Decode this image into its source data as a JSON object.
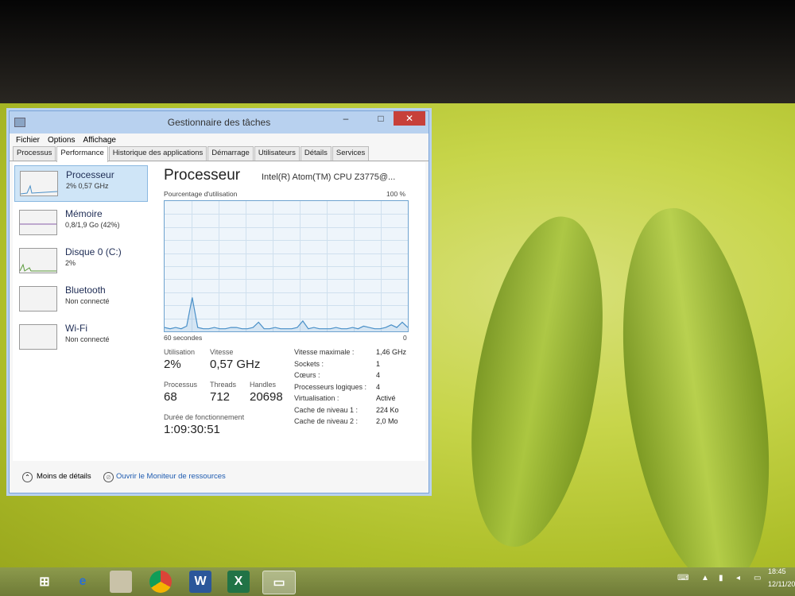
{
  "window": {
    "title": "Gestionnaire des tâches",
    "minimize": "–",
    "maximize": "□",
    "close": "✕"
  },
  "menu": [
    "Fichier",
    "Options",
    "Affichage"
  ],
  "tabs": [
    "Processus",
    "Performance",
    "Historique des applications",
    "Démarrage",
    "Utilisateurs",
    "Détails",
    "Services"
  ],
  "sidebar": {
    "items": [
      {
        "name": "Processeur",
        "sub": "2% 0,57 GHz"
      },
      {
        "name": "Mémoire",
        "sub": "0,8/1,9 Go (42%)"
      },
      {
        "name": "Disque 0 (C:)",
        "sub": "2%"
      },
      {
        "name": "Bluetooth",
        "sub": "Non connecté"
      },
      {
        "name": "Wi-Fi",
        "sub": "Non connecté"
      }
    ]
  },
  "main": {
    "title": "Processeur",
    "model": "Intel(R) Atom(TM) CPU Z3775@...",
    "graph_label": "Pourcentage d'utilisation",
    "graph_max": "100 %",
    "graph_left": "60 secondes",
    "graph_right": "0",
    "usage_points": [
      3,
      2,
      3,
      2,
      4,
      26,
      3,
      2,
      2,
      3,
      2,
      2,
      3,
      3,
      2,
      2,
      3,
      7,
      2,
      2,
      3,
      2,
      2,
      2,
      3,
      8,
      2,
      3,
      2,
      2,
      2,
      3,
      2,
      2,
      3,
      2,
      4,
      3,
      2,
      2,
      3,
      5,
      3,
      7,
      3
    ],
    "stats": {
      "utilisation_label": "Utilisation",
      "utilisation": "2%",
      "vitesse_label": "Vitesse",
      "vitesse": "0,57 GHz",
      "processus_label": "Processus",
      "processus": "68",
      "threads_label": "Threads",
      "threads": "712",
      "handles_label": "Handles",
      "handles": "20698",
      "uptime_label": "Durée de fonctionnement",
      "uptime": "1:09:30:51"
    },
    "details": [
      {
        "k": "Vitesse maximale :",
        "v": "1,46 GHz"
      },
      {
        "k": "Sockets :",
        "v": "1"
      },
      {
        "k": "Cœurs :",
        "v": "4"
      },
      {
        "k": "Processeurs logiques :",
        "v": "4"
      },
      {
        "k": "Virtualisation :",
        "v": "Activé"
      },
      {
        "k": "Cache de niveau 1 :",
        "v": "224 Ko"
      },
      {
        "k": "Cache de niveau 2 :",
        "v": "2,0 Mo"
      }
    ]
  },
  "footer": {
    "less_details": "Moins de détails",
    "resource_monitor": "Ouvrir le Moniteur de ressources"
  },
  "tray": {
    "time": "18:45",
    "date": "12/11/20"
  },
  "colors": {
    "graph_line": "#4a90c8",
    "accent": "#1e5bb0"
  }
}
